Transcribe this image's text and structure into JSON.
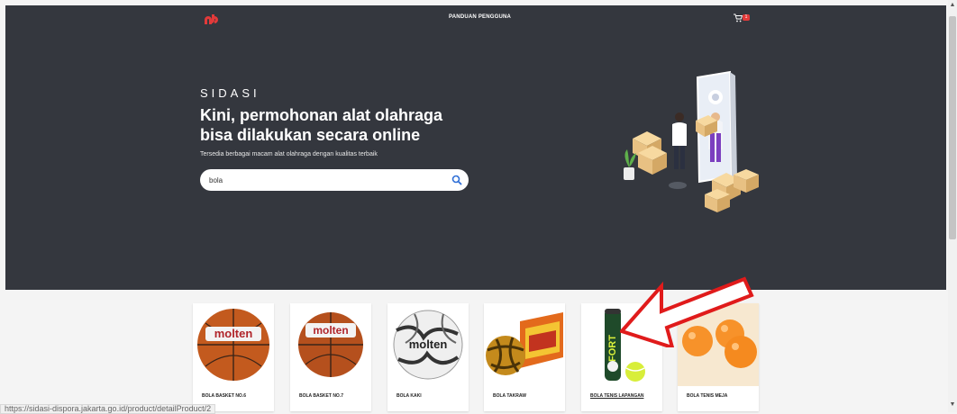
{
  "nav": {
    "link": "PANDUAN PENGGUNA",
    "cart_count": "1"
  },
  "hero": {
    "eyebrow": "SIDASI",
    "headline_line1": "Kini, permohonan alat olahraga",
    "headline_line2": "bisa dilakukan secara online",
    "subtitle": "Tersedia berbagai macam alat olahraga dengan kualitas terbaik",
    "search_value": "bola"
  },
  "products": [
    {
      "label": "BOLA BASKET NO.6",
      "brand": "molten"
    },
    {
      "label": "BOLA BASKET NO.7",
      "brand": "molten"
    },
    {
      "label": "BOLA KAKI",
      "brand": "molten"
    },
    {
      "label": "BOLA TAKRAW"
    },
    {
      "label": "BOLA TENIS LAPANGAN",
      "brand": "FORT"
    },
    {
      "label": "BOLA TENIS MEJA"
    }
  ],
  "status_url": "https://sidasi-dispora.jakarta.go.id/product/detailProduct/2",
  "colors": {
    "hero_bg": "#34373e",
    "brand_red": "#e23a3a",
    "annotation_red": "#e01b1b"
  },
  "icons": [
    "logo",
    "cart-icon",
    "search-icon",
    "arrow-annotation"
  ]
}
